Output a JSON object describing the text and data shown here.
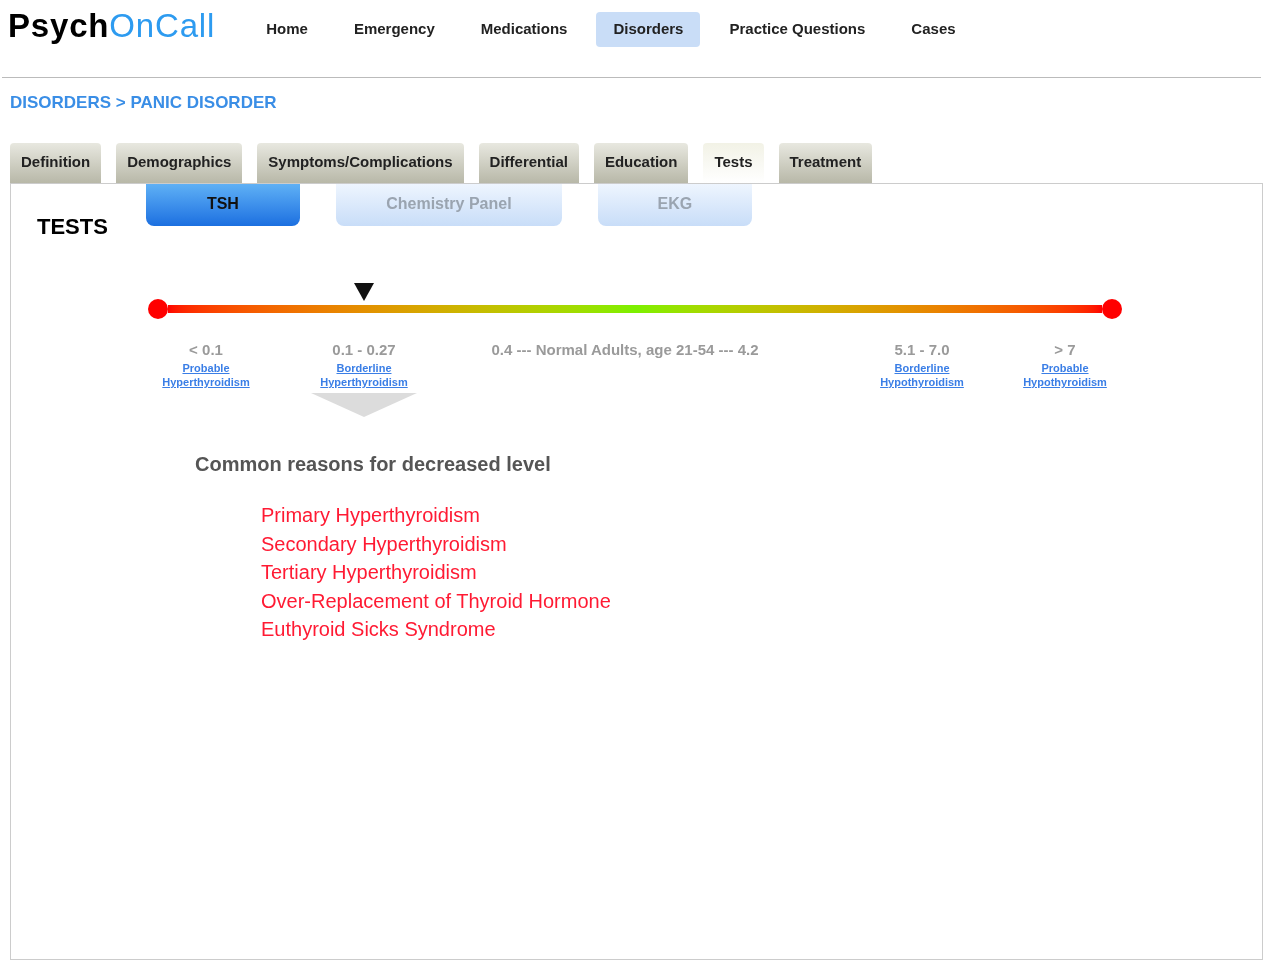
{
  "logo": {
    "dark": "Psych",
    "accent": "OnCall"
  },
  "nav": [
    {
      "label": "Home",
      "selected": false
    },
    {
      "label": "Emergency",
      "selected": false
    },
    {
      "label": "Medications",
      "selected": false
    },
    {
      "label": "Disorders",
      "selected": true
    },
    {
      "label": "Practice Questions",
      "selected": false
    },
    {
      "label": "Cases",
      "selected": false
    }
  ],
  "breadcrumb": "DISORDERS > PANIC DISORDER",
  "tabs": [
    {
      "label": "Definition",
      "selected": false
    },
    {
      "label": "Demographics",
      "selected": false
    },
    {
      "label": "Symptoms/Complications",
      "selected": false
    },
    {
      "label": "Differential",
      "selected": false
    },
    {
      "label": "Education",
      "selected": false
    },
    {
      "label": "Tests",
      "selected": true
    },
    {
      "label": "Treatment",
      "selected": false
    }
  ],
  "section_title": "TESTS",
  "subtabs": [
    {
      "label": "TSH",
      "selected": true
    },
    {
      "label": "Chemistry Panel",
      "selected": false
    },
    {
      "label": "EKG",
      "selected": false
    }
  ],
  "scale": {
    "level": 0.21
  },
  "ranges": [
    {
      "value": "< 0.1",
      "link": [
        "Probable",
        "Hyperthyroidism"
      ],
      "selected": false
    },
    {
      "value": "0.1 - 0.27",
      "link": [
        "Borderline",
        "Hyperthyroidism"
      ],
      "selected": true
    },
    {
      "value": "0.4 --- Normal Adults, age 21-54 --- 4.2",
      "selected": false
    },
    {
      "value": "5.1 - 7.0",
      "link": [
        "Borderline",
        "Hypothyroidism"
      ],
      "selected": false
    },
    {
      "value": "> 7",
      "link": [
        "Probable",
        "Hypothyroidism"
      ],
      "selected": false
    }
  ],
  "reasons_title": "Common reasons for decreased level",
  "reasons": [
    "Primary Hyperthyroidism",
    "Secondary Hyperthyroidism",
    "Tertiary Hyperthyroidism",
    "Over-Replacement of Thyroid Hormone",
    "Euthyroid Sicks Syndrome"
  ]
}
